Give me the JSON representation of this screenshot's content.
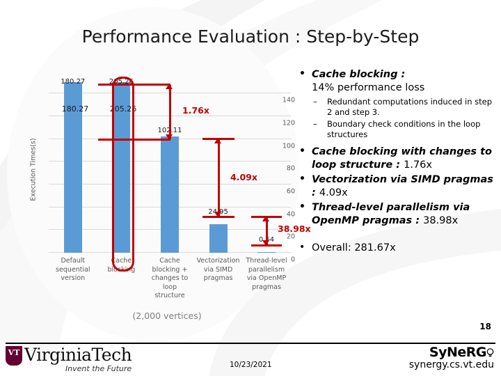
{
  "slide": {
    "title": "Performance Evaluation : Step-by-Step",
    "number": "18",
    "caption": "(2,000 vertices)"
  },
  "chart_data": {
    "type": "bar",
    "title": "",
    "xlabel": "",
    "ylabel": "Execution Times(s)",
    "ylim": [
      0,
      150
    ],
    "yticks": [
      "0",
      "20",
      "40",
      "60",
      "80",
      "100",
      "120",
      "140"
    ],
    "grid": true,
    "legend": "none",
    "categories": [
      "Default sequential version",
      "Cache blocking",
      "Cache blocking + changes to loop structure",
      "Vectorization via SIMD pragmas",
      "Thread-level parallelism via OpenMP pragmas"
    ],
    "values": [
      180.27,
      205.26,
      102.11,
      24.95,
      0.64
    ],
    "value_labels": [
      "180.27",
      "205.26",
      "102.11",
      "24.95",
      "0.64"
    ],
    "bar_color": "#5b9bd5",
    "annotation_color": "#c00000",
    "annotations": [
      {
        "label": "1.76x",
        "from": "Cache blocking",
        "to": "Cache blocking + changes to loop structure"
      },
      {
        "label": "4.09x",
        "from": "Cache blocking + changes to loop structure",
        "to": "Vectorization via SIMD pragmas"
      },
      {
        "label": "38.98x",
        "from": "Vectorization via SIMD pragmas",
        "to": "Thread-level parallelism via OpenMP pragmas"
      }
    ],
    "highlighted_category": "Cache blocking"
  },
  "bullets": {
    "b1_head": "Cache blocking :",
    "b1_sub": "14% performance loss",
    "b1_item1": "Redundant computations induced in step 2 and step 3.",
    "b1_item2": "Boundary check conditions in the loop structures",
    "b2_head": "Cache blocking with changes to loop structure :",
    "b2_value": "1.76x",
    "b3_head": "Vectorization via SIMD pragmas :",
    "b3_value": "4.09x",
    "b4_head": "Thread-level parallelism via OpenMP pragmas :",
    "b4_value": "38.98x",
    "overall_label": "Overall:",
    "overall_value": "281.67x"
  },
  "footer": {
    "university": "VirginiaTech",
    "tagline": "Invent the Future",
    "shield": "VT",
    "date": "10/23/2021",
    "lab_logo": "SyNeRG",
    "lab_url": "synergy.cs.vt.edu"
  }
}
